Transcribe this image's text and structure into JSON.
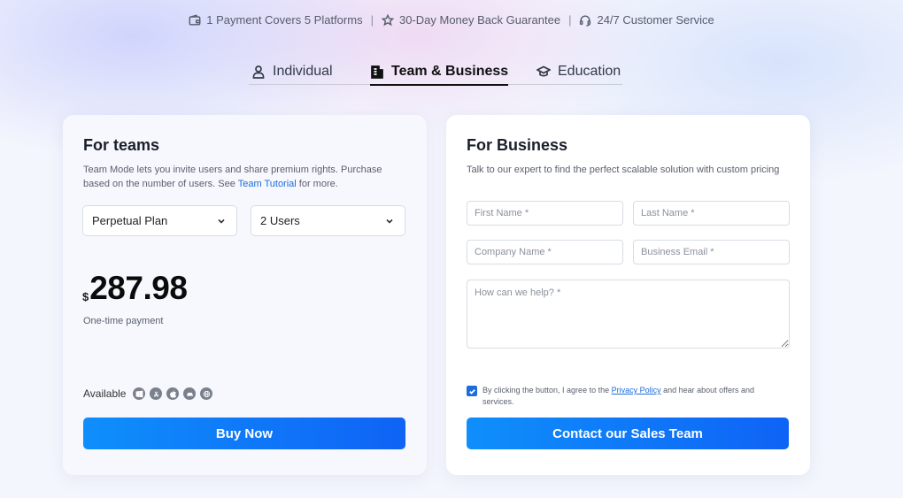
{
  "topbar": {
    "items": [
      {
        "icon": "wallet-icon",
        "text": "1 Payment Covers 5 Platforms"
      },
      {
        "icon": "star-icon",
        "text": "30-Day Money Back Guarantee"
      },
      {
        "icon": "headset-icon",
        "text": "24/7 Customer Service"
      }
    ],
    "separator": "|"
  },
  "tabs": [
    {
      "icon": "user-icon",
      "label": "Individual",
      "active": false
    },
    {
      "icon": "building-icon",
      "label": "Team & Business",
      "active": true
    },
    {
      "icon": "graduation-cap-icon",
      "label": "Education",
      "active": false
    }
  ],
  "teams": {
    "title": "For teams",
    "desc_before": "Team Mode lets you invite users and share premium rights. Purchase based on the number of users. See ",
    "desc_link": "Team Tutorial",
    "desc_after": " for more.",
    "plan_select": "Perpetual Plan",
    "users_select": "2 Users",
    "currency": "$",
    "price": "287.98",
    "payment_note": "One-time payment",
    "available_label": "Available",
    "platforms": [
      "windows-icon",
      "app-store-icon",
      "apple-icon",
      "android-icon",
      "web-icon"
    ],
    "buy_button": "Buy Now"
  },
  "business": {
    "title": "For Business",
    "desc": "Talk to our expert to find the perfect scalable solution with custom pricing",
    "first_name_placeholder": "First Name *",
    "last_name_placeholder": "Last Name *",
    "company_placeholder": "Company Name *",
    "email_placeholder": "Business Email *",
    "help_placeholder": "How can we help? *",
    "consent_before": "By clicking the button, I agree to the ",
    "consent_link": "Privacy Policy",
    "consent_after": " and hear about offers and services.",
    "consent_checked": true,
    "contact_button": "Contact our Sales Team"
  },
  "colors": {
    "accent": "#0f63f6",
    "link": "#1a6ddb"
  }
}
